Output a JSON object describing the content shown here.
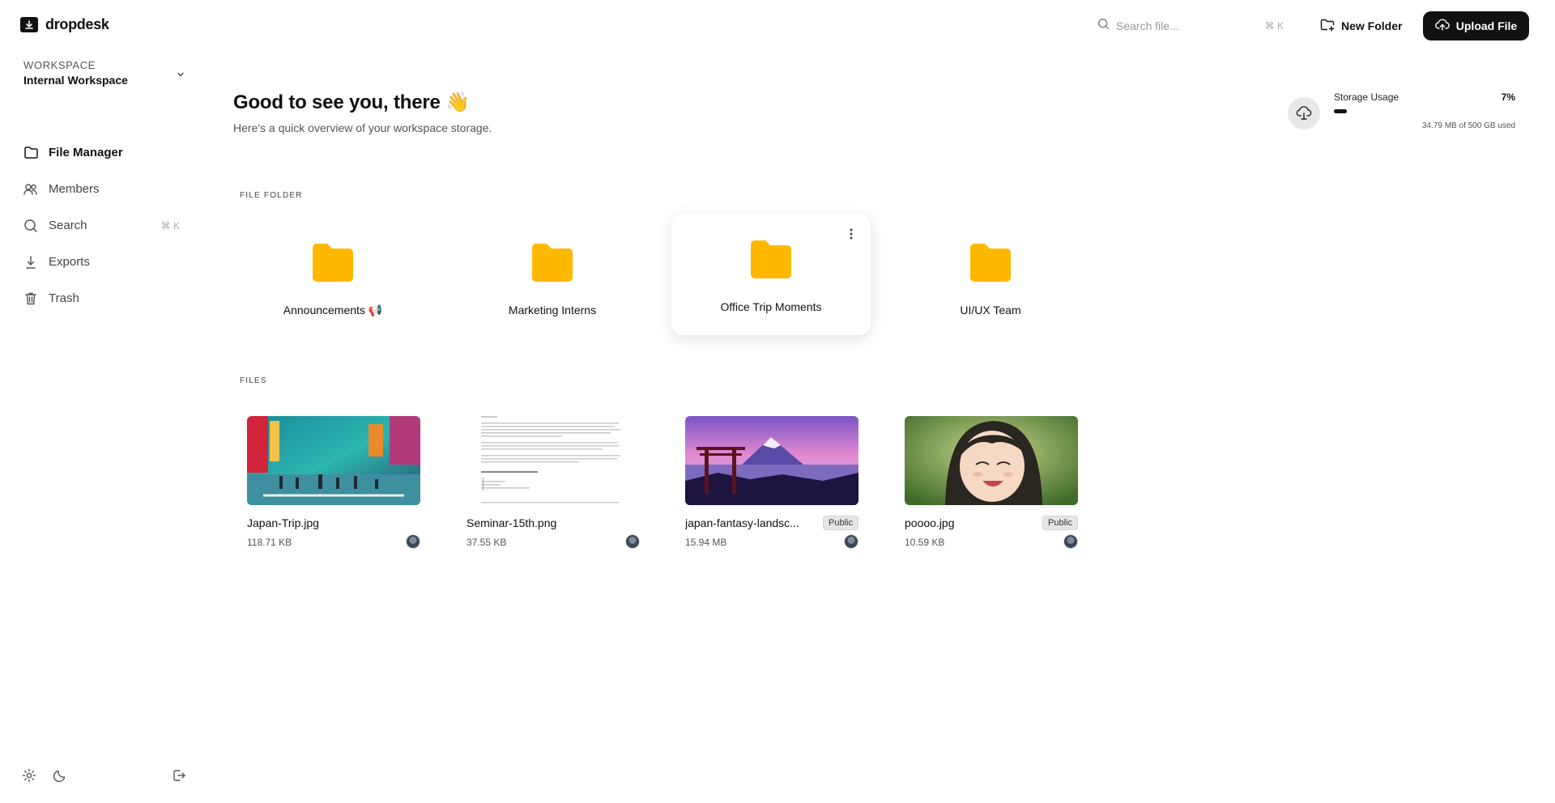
{
  "app": {
    "name": "dropdesk"
  },
  "workspace": {
    "label": "WORKSPACE",
    "name": "Internal Workspace"
  },
  "nav": [
    {
      "label": "File Manager",
      "icon": "folder-icon",
      "active": true
    },
    {
      "label": "Members",
      "icon": "users-icon"
    },
    {
      "label": "Search",
      "icon": "search-icon",
      "shortcut": "⌘ K"
    },
    {
      "label": "Exports",
      "icon": "download-icon"
    },
    {
      "label": "Trash",
      "icon": "trash-icon"
    }
  ],
  "topbar": {
    "search_placeholder": "Search file...",
    "search_shortcut": "⌘ K",
    "new_folder_label": "New Folder",
    "upload_label": "Upload File"
  },
  "greeting": {
    "title": "Good to see you, there 👋",
    "subtitle": "Here's a quick overview of your workspace storage."
  },
  "storage": {
    "title": "Storage Usage",
    "percent_label": "7%",
    "percent_value": 0.07,
    "used_text": "34.79 MB of 500 GB used"
  },
  "sections": {
    "folders_label": "FILE FOLDER",
    "files_label": "FILES"
  },
  "folders": [
    {
      "name": "Announcements 📢"
    },
    {
      "name": "Marketing Interns"
    },
    {
      "name": "Office Trip Moments",
      "hovered": true
    },
    {
      "name": "UI/UX Team"
    }
  ],
  "files": [
    {
      "name": "Japan-Trip.jpg",
      "size": "118.71 KB",
      "badge": ""
    },
    {
      "name": "Seminar-15th.png",
      "size": "37.55 KB",
      "badge": ""
    },
    {
      "name": "japan-fantasy-landsc...",
      "size": "15.94 MB",
      "badge": "Public"
    },
    {
      "name": "poooo.jpg",
      "size": "10.59 KB",
      "badge": "Public"
    }
  ],
  "colors": {
    "accent": "#111111",
    "folder": "#FFB800",
    "background": "#FFFFFF"
  }
}
